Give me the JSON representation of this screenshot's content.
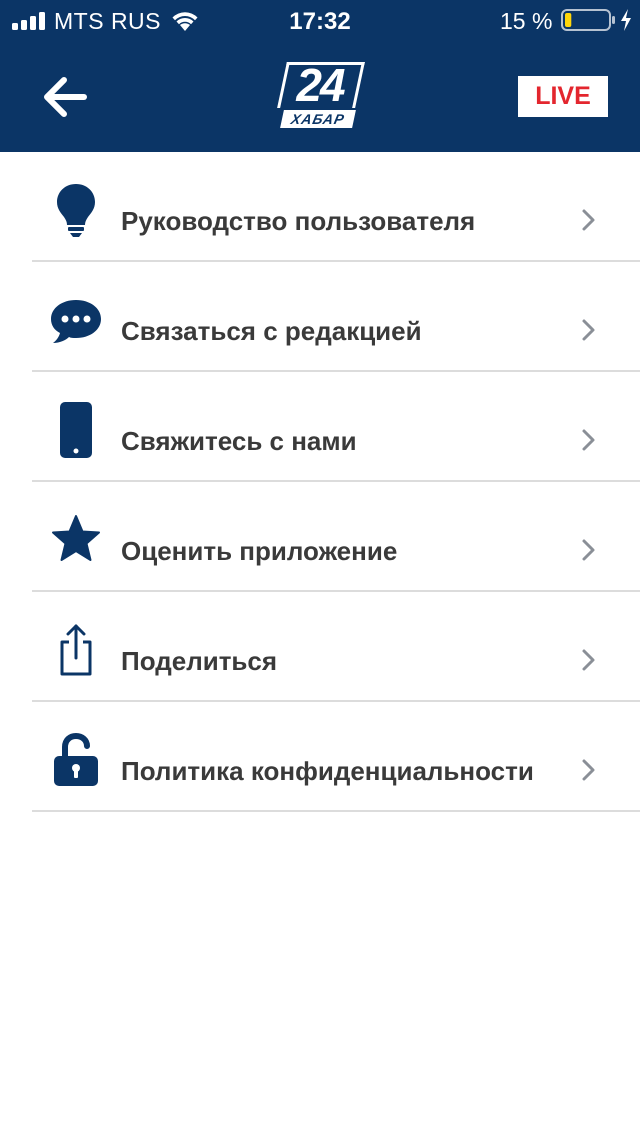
{
  "status_bar": {
    "carrier": "MTS RUS",
    "time": "17:32",
    "battery_percent": "15 %",
    "battery_level": 0.15
  },
  "header": {
    "logo_number": "24",
    "logo_word": "ХАБАР",
    "live_label": "LIVE"
  },
  "colors": {
    "brand": "#0b3566",
    "live": "#e3262e",
    "text": "#3a3a3a",
    "chevron": "#8a8f97",
    "divider": "#dcdcdc"
  },
  "menu": {
    "items": [
      {
        "label": "Руководство пользователя",
        "icon": "lightbulb-icon"
      },
      {
        "label": "Связаться с редакцией",
        "icon": "chat-bubble-icon"
      },
      {
        "label": "Свяжитесь с нами",
        "icon": "phone-icon"
      },
      {
        "label": "Оценить приложение",
        "icon": "star-icon"
      },
      {
        "label": "Поделиться",
        "icon": "share-icon"
      },
      {
        "label": "Политика конфиденциальности",
        "icon": "unlock-icon"
      }
    ]
  }
}
